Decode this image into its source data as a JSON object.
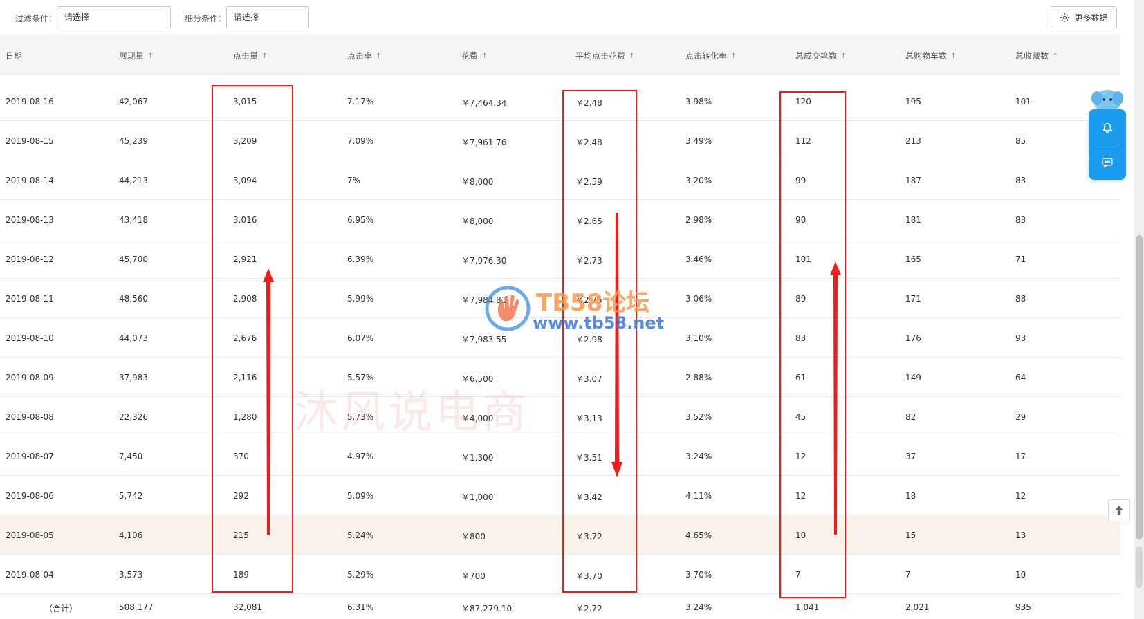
{
  "filters": {
    "filter_label": "过滤条件：",
    "filter_value": "请选择",
    "sub_label": "细分条件：",
    "sub_value": "请选择",
    "more_label": "更多数据"
  },
  "columns": [
    "日期",
    "展现量",
    "点击量",
    "点击率",
    "花费",
    "平均点击花费",
    "点击转化率",
    "总成交笔数",
    "总购物车数",
    "总收藏数"
  ],
  "rows": [
    [
      "2019-08-16",
      "42,067",
      "3,015",
      "7.17%",
      "￥7,464.34",
      "￥2.48",
      "3.98%",
      "120",
      "195",
      "101"
    ],
    [
      "2019-08-15",
      "45,239",
      "3,209",
      "7.09%",
      "￥7,961.76",
      "￥2.48",
      "3.49%",
      "112",
      "213",
      "85"
    ],
    [
      "2019-08-14",
      "44,213",
      "3,094",
      "7%",
      "￥8,000",
      "￥2.59",
      "3.20%",
      "99",
      "187",
      "83"
    ],
    [
      "2019-08-13",
      "43,418",
      "3,016",
      "6.95%",
      "￥8,000",
      "￥2.65",
      "2.98%",
      "90",
      "181",
      "83"
    ],
    [
      "2019-08-12",
      "45,700",
      "2,921",
      "6.39%",
      "￥7,976.30",
      "￥2.73",
      "3.46%",
      "101",
      "165",
      "71"
    ],
    [
      "2019-08-11",
      "48,560",
      "2,908",
      "5.99%",
      "￥7,984.81",
      "￥2.75",
      "3.06%",
      "89",
      "171",
      "88"
    ],
    [
      "2019-08-10",
      "44,073",
      "2,676",
      "6.07%",
      "￥7,983.55",
      "￥2.98",
      "3.10%",
      "83",
      "176",
      "93"
    ],
    [
      "2019-08-09",
      "37,983",
      "2,116",
      "5.57%",
      "￥6,500",
      "￥3.07",
      "2.88%",
      "61",
      "149",
      "64"
    ],
    [
      "2019-08-08",
      "22,326",
      "1,280",
      "5.73%",
      "￥4,000",
      "￥3.13",
      "3.52%",
      "45",
      "82",
      "29"
    ],
    [
      "2019-08-07",
      "7,450",
      "370",
      "4.97%",
      "￥1,300",
      "￥3.51",
      "3.24%",
      "12",
      "37",
      "17"
    ],
    [
      "2019-08-06",
      "5,742",
      "292",
      "5.09%",
      "￥1,000",
      "￥3.42",
      "4.11%",
      "12",
      "18",
      "12"
    ],
    [
      "2019-08-05",
      "4,106",
      "215",
      "5.24%",
      "￥800",
      "￥3.72",
      "4.65%",
      "10",
      "15",
      "13"
    ],
    [
      "2019-08-04",
      "3,573",
      "189",
      "5.29%",
      "￥700",
      "￥3.70",
      "3.70%",
      "7",
      "7",
      "10"
    ]
  ],
  "highlight_row": "2019-08-05",
  "totals": [
    "（合计）",
    "508,177",
    "32,081",
    "6.31%",
    "￥87,279.10",
    "￥2.72",
    "3.24%",
    "1,041",
    "2,021",
    "935"
  ],
  "watermark": {
    "brand": "TB58论坛",
    "url": "www.tb58.net",
    "calligraphy": "沐风说电商"
  },
  "colors": {
    "annotation_red": "#ee1c1c",
    "float_panel_blue": "#1a9cf1",
    "highlight_row_bg": "#f9f3ec"
  },
  "icons": {
    "more_button": "gear-icon",
    "float_1": "bell-icon",
    "float_2": "message-icon",
    "back_to_top": "arrow-up-icon"
  }
}
